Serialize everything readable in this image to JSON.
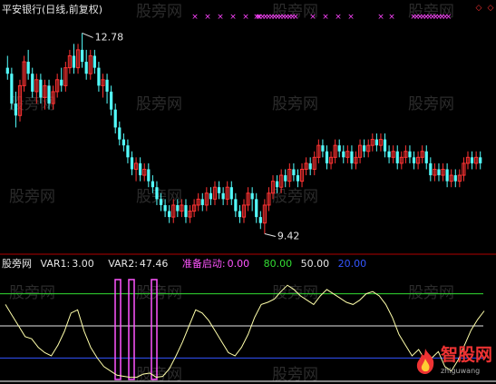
{
  "window": {
    "title": "平安银行(日线,前复权)"
  },
  "watermark": "股旁网",
  "logo": {
    "name": "智股网",
    "url": "zhiguwang"
  },
  "colors": {
    "background": "#000000",
    "candle_up": "#ff3333",
    "candle_down": "#54ffff",
    "indicator_line": "#ffffaa",
    "signal_bar": "#ff55ff",
    "level_green": "#33dd33",
    "level_white": "#e6e6e6",
    "level_blue": "#3355ff",
    "divider": "#b00000",
    "marker_magenta": "#ff44ff",
    "marker_red": "#ff3333"
  },
  "indicator_header": {
    "name": "股旁网",
    "var1_label": "VAR1:",
    "var1": "3.00",
    "var2_label": "VAR2:",
    "var2": "47.46",
    "signal_label": "准备启动:",
    "signal": "0.00",
    "level_a": "80.00",
    "level_b": "50.00",
    "level_c": "20.00"
  },
  "chart_data": [
    {
      "type": "candlestick",
      "title": "平安银行(日线,前复权)",
      "annotations": [
        {
          "text": "12.78",
          "value": 12.78,
          "index": 18
        },
        {
          "text": "9.42",
          "value": 9.42,
          "index": 62
        }
      ],
      "ylim": [
        9.2,
        13.0
      ],
      "candles": [
        [
          12.2,
          12.1,
          12.4,
          12.0
        ],
        [
          12.1,
          11.6,
          12.2,
          11.5
        ],
        [
          11.6,
          11.4,
          11.8,
          11.2
        ],
        [
          11.4,
          11.9,
          12.0,
          11.3
        ],
        [
          11.9,
          12.3,
          12.4,
          11.8
        ],
        [
          12.3,
          12.1,
          12.5,
          12.0
        ],
        [
          12.1,
          11.8,
          12.2,
          11.7
        ],
        [
          11.8,
          12.0,
          12.1,
          11.6
        ],
        [
          12.0,
          11.7,
          12.1,
          11.6
        ],
        [
          11.7,
          11.9,
          12.0,
          11.5
        ],
        [
          11.9,
          11.6,
          12.0,
          11.5
        ],
        [
          11.6,
          11.8,
          11.9,
          11.5
        ],
        [
          11.8,
          12.0,
          12.1,
          11.7
        ],
        [
          12.0,
          11.9,
          12.2,
          11.8
        ],
        [
          11.9,
          12.2,
          12.3,
          11.8
        ],
        [
          12.2,
          12.4,
          12.5,
          12.1
        ],
        [
          12.4,
          12.2,
          12.6,
          12.1
        ],
        [
          12.2,
          12.5,
          12.6,
          12.1
        ],
        [
          12.5,
          12.3,
          12.78,
          12.2
        ],
        [
          12.3,
          12.1,
          12.5,
          12.0
        ],
        [
          12.1,
          12.4,
          12.5,
          12.0
        ],
        [
          12.4,
          12.2,
          12.5,
          12.1
        ],
        [
          12.2,
          11.9,
          12.3,
          11.8
        ],
        [
          11.9,
          12.0,
          12.1,
          11.7
        ],
        [
          12.0,
          11.8,
          12.1,
          11.6
        ],
        [
          11.8,
          11.5,
          11.9,
          11.4
        ],
        [
          11.5,
          11.2,
          11.6,
          11.1
        ],
        [
          11.2,
          11.0,
          11.3,
          10.9
        ],
        [
          11.0,
          10.9,
          11.1,
          10.8
        ],
        [
          10.9,
          10.7,
          11.0,
          10.6
        ],
        [
          10.7,
          10.5,
          10.8,
          10.4
        ],
        [
          10.5,
          10.6,
          10.7,
          10.3
        ],
        [
          10.6,
          10.4,
          10.7,
          10.3
        ],
        [
          10.4,
          10.5,
          10.6,
          10.3
        ],
        [
          10.5,
          10.3,
          10.6,
          10.2
        ],
        [
          10.3,
          10.2,
          10.4,
          10.1
        ],
        [
          10.2,
          10.0,
          10.3,
          9.9
        ],
        [
          10.0,
          9.9,
          10.1,
          9.8
        ],
        [
          9.9,
          9.8,
          10.0,
          9.7
        ],
        [
          9.8,
          9.7,
          9.9,
          9.6
        ],
        [
          9.7,
          9.9,
          10.0,
          9.6
        ],
        [
          9.9,
          9.8,
          10.0,
          9.7
        ],
        [
          9.8,
          9.9,
          10.0,
          9.7
        ],
        [
          9.9,
          9.7,
          10.0,
          9.6
        ],
        [
          9.7,
          9.8,
          9.9,
          9.6
        ],
        [
          9.8,
          9.9,
          10.0,
          9.7
        ],
        [
          9.9,
          10.0,
          10.1,
          9.8
        ],
        [
          10.0,
          9.9,
          10.1,
          9.8
        ],
        [
          9.9,
          10.1,
          10.2,
          9.8
        ],
        [
          10.1,
          10.0,
          10.2,
          9.9
        ],
        [
          10.0,
          10.2,
          10.3,
          9.9
        ],
        [
          10.2,
          10.1,
          10.3,
          10.0
        ],
        [
          10.1,
          10.0,
          10.2,
          9.9
        ],
        [
          10.0,
          10.2,
          10.3,
          9.9
        ],
        [
          10.2,
          10.0,
          10.3,
          9.9
        ],
        [
          10.0,
          9.8,
          10.1,
          9.7
        ],
        [
          9.8,
          9.7,
          9.9,
          9.6
        ],
        [
          9.7,
          9.9,
          10.0,
          9.6
        ],
        [
          9.9,
          10.1,
          10.2,
          9.8
        ],
        [
          10.1,
          10.0,
          10.2,
          9.8
        ],
        [
          10.0,
          9.7,
          10.1,
          9.6
        ],
        [
          9.7,
          9.6,
          9.8,
          9.5
        ],
        [
          9.6,
          9.9,
          10.0,
          9.42
        ],
        [
          9.9,
          10.1,
          10.2,
          9.8
        ],
        [
          10.1,
          10.3,
          10.4,
          10.0
        ],
        [
          10.3,
          10.2,
          10.4,
          10.1
        ],
        [
          10.2,
          10.4,
          10.5,
          10.1
        ],
        [
          10.4,
          10.3,
          10.5,
          10.2
        ],
        [
          10.3,
          10.5,
          10.6,
          10.2
        ],
        [
          10.5,
          10.4,
          10.6,
          10.3
        ],
        [
          10.4,
          10.3,
          10.5,
          10.2
        ],
        [
          10.3,
          10.5,
          10.6,
          10.2
        ],
        [
          10.5,
          10.6,
          10.7,
          10.4
        ],
        [
          10.6,
          10.5,
          10.7,
          10.4
        ],
        [
          10.5,
          10.7,
          10.8,
          10.4
        ],
        [
          10.7,
          10.9,
          11.0,
          10.6
        ],
        [
          10.9,
          10.8,
          11.0,
          10.7
        ],
        [
          10.8,
          10.6,
          10.9,
          10.5
        ],
        [
          10.6,
          10.7,
          10.8,
          10.5
        ],
        [
          10.7,
          10.9,
          11.0,
          10.6
        ],
        [
          10.9,
          10.8,
          11.0,
          10.7
        ],
        [
          10.8,
          10.7,
          10.9,
          10.6
        ],
        [
          10.7,
          10.8,
          10.9,
          10.6
        ],
        [
          10.8,
          10.6,
          10.9,
          10.5
        ],
        [
          10.6,
          10.7,
          10.8,
          10.5
        ],
        [
          10.7,
          10.9,
          11.0,
          10.6
        ],
        [
          10.9,
          10.8,
          11.0,
          10.7
        ],
        [
          10.8,
          10.9,
          11.0,
          10.7
        ],
        [
          10.9,
          11.0,
          11.1,
          10.8
        ],
        [
          11.0,
          10.9,
          11.1,
          10.8
        ],
        [
          10.9,
          11.0,
          11.1,
          10.8
        ],
        [
          11.0,
          10.8,
          11.1,
          10.7
        ],
        [
          10.8,
          10.7,
          10.9,
          10.6
        ],
        [
          10.7,
          10.8,
          10.9,
          10.6
        ],
        [
          10.8,
          10.6,
          10.9,
          10.5
        ],
        [
          10.6,
          10.7,
          10.8,
          10.5
        ],
        [
          10.7,
          10.8,
          10.9,
          10.6
        ],
        [
          10.8,
          10.7,
          10.9,
          10.6
        ],
        [
          10.7,
          10.6,
          10.8,
          10.5
        ],
        [
          10.6,
          10.7,
          10.8,
          10.5
        ],
        [
          10.7,
          10.8,
          10.9,
          10.6
        ],
        [
          10.8,
          10.6,
          10.9,
          10.5
        ],
        [
          10.6,
          10.4,
          10.7,
          10.3
        ],
        [
          10.4,
          10.5,
          10.6,
          10.3
        ],
        [
          10.5,
          10.4,
          10.6,
          10.3
        ],
        [
          10.4,
          10.5,
          10.6,
          10.3
        ],
        [
          10.5,
          10.3,
          10.6,
          10.2
        ],
        [
          10.3,
          10.4,
          10.5,
          10.2
        ],
        [
          10.4,
          10.3,
          10.5,
          10.2
        ],
        [
          10.3,
          10.4,
          10.5,
          10.2
        ],
        [
          10.4,
          10.6,
          10.7,
          10.3
        ],
        [
          10.6,
          10.7,
          10.8,
          10.5
        ],
        [
          10.7,
          10.6,
          10.8,
          10.5
        ],
        [
          10.6,
          10.7,
          10.8,
          10.5
        ],
        [
          10.7,
          10.6,
          10.8,
          10.5
        ]
      ]
    },
    {
      "type": "line",
      "series": [
        {
          "values": [
            70,
            60,
            50,
            40,
            38,
            30,
            25,
            22,
            32,
            45,
            62,
            65,
            45,
            30,
            20,
            12,
            8,
            4,
            3,
            2,
            2,
            5,
            6,
            2,
            3,
            10,
            22,
            35,
            50,
            65,
            62,
            55,
            45,
            35,
            25,
            22,
            30,
            42,
            58,
            70,
            72,
            75,
            82,
            88,
            84,
            78,
            74,
            70,
            78,
            84,
            80,
            76,
            72,
            70,
            74,
            80,
            82,
            78,
            70,
            58,
            42,
            32,
            22,
            28,
            18,
            20,
            26,
            12,
            8,
            18,
            32,
            46,
            56,
            64
          ]
        }
      ],
      "levels": [
        80,
        50,
        20
      ],
      "signal_bars": [
        3,
        3,
        3
      ],
      "ylim": [
        0,
        100
      ]
    }
  ]
}
